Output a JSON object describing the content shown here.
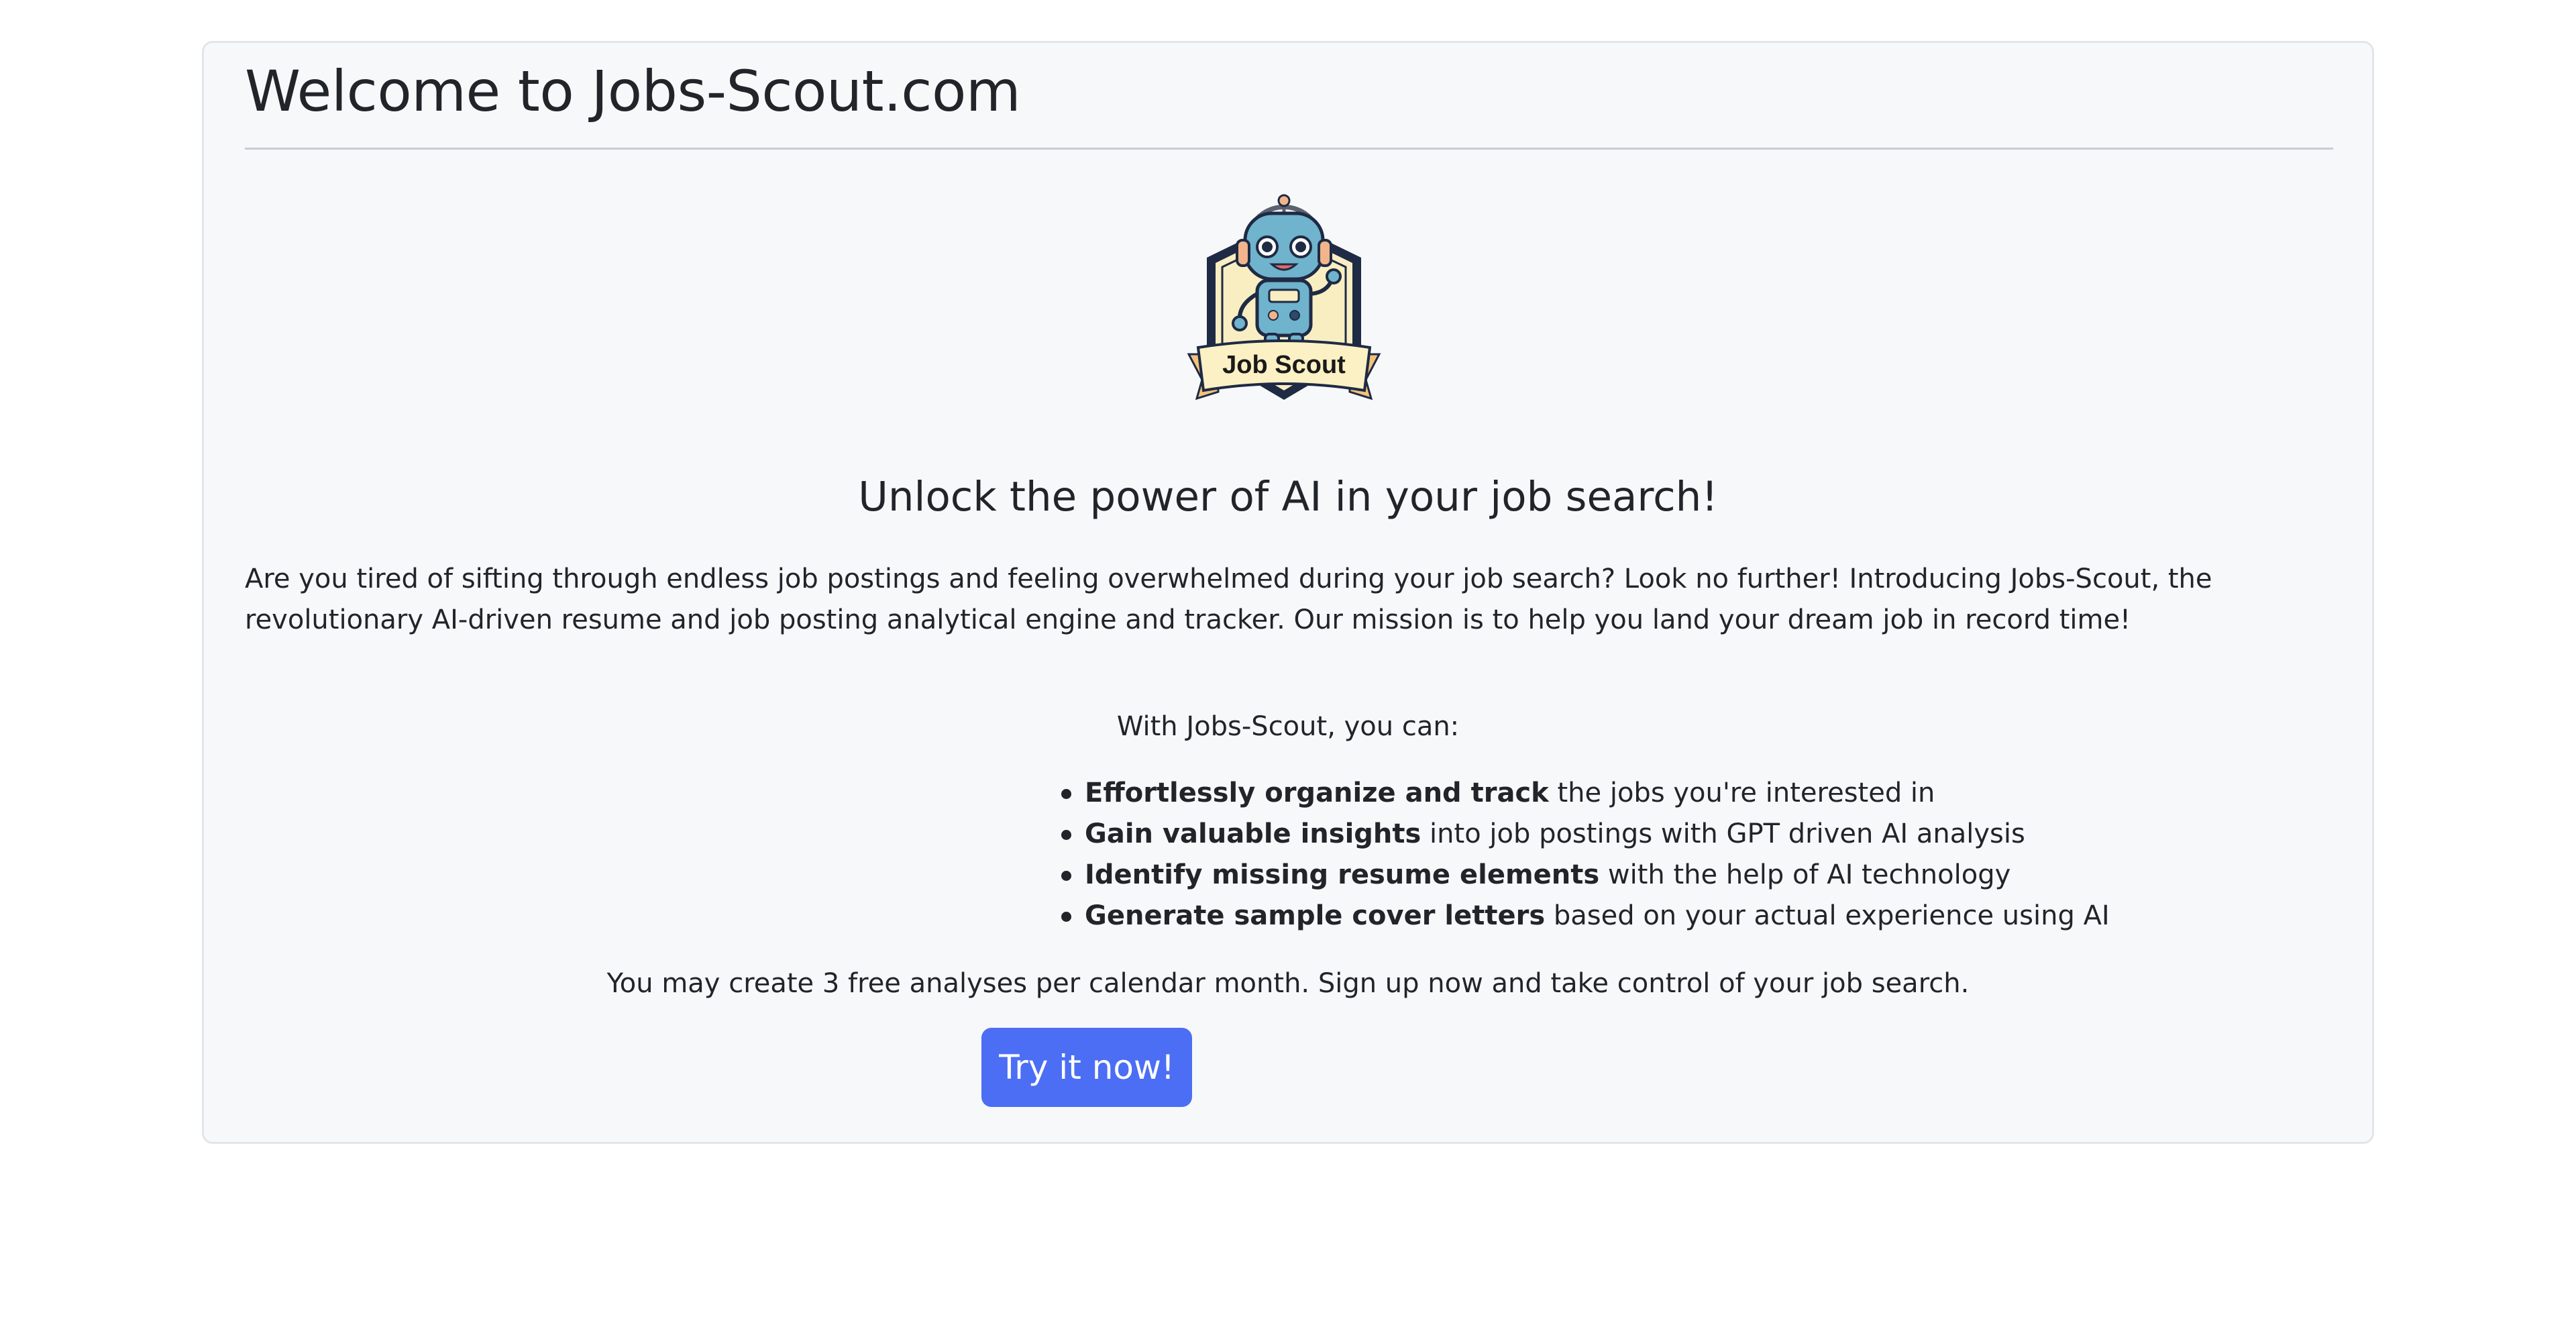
{
  "card": {
    "title": "Welcome to Jobs-Scout.com"
  },
  "logo": {
    "text": "Job Scout",
    "icon": "robot-badge-logo"
  },
  "main": {
    "headline": "Unlock the power of AI in your job search!",
    "intro": "Are you tired of sifting through endless job postings and feeling overwhelmed during your job search? Look no further! Introducing Jobs-Scout, the revolutionary AI-driven resume and job posting analytical engine and tracker. Our mission is to help you land your dream job in record time!",
    "with_label": "With Jobs-Scout, you can:",
    "features": [
      {
        "bold": "Effortlessly organize and track",
        "rest": " the jobs you're interested in"
      },
      {
        "bold": "Gain valuable insights",
        "rest": " into job postings with GPT driven AI analysis"
      },
      {
        "bold": "Identify missing resume elements",
        "rest": " with the help of AI technology"
      },
      {
        "bold": "Generate sample cover letters",
        "rest": " based on your actual experience using AI"
      }
    ],
    "outro": "You may create 3 free analyses per calendar month. Sign up now and take control of your job search."
  },
  "cta": {
    "label": "Try it now!"
  },
  "colors": {
    "button": "#4b6ef5",
    "card_background": "#f7f8fa",
    "text": "#212529"
  }
}
